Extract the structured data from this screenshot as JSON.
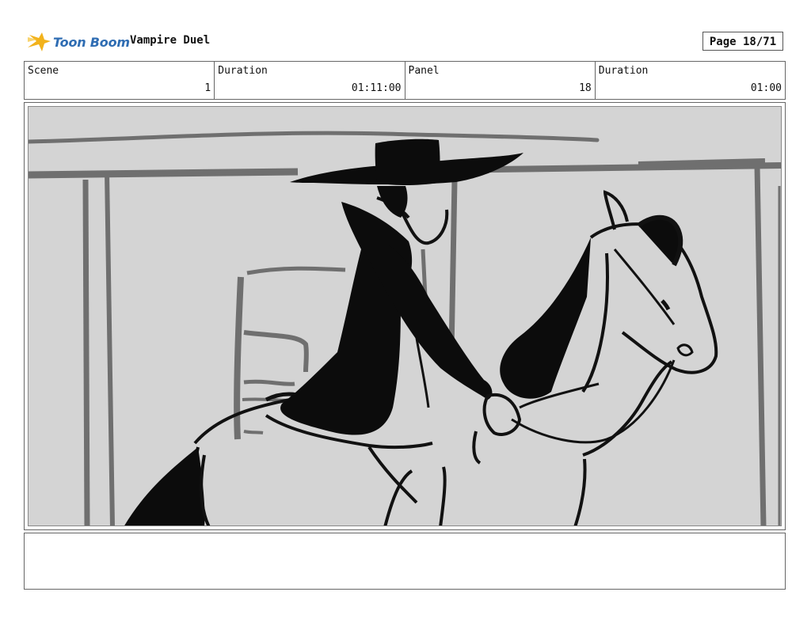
{
  "header": {
    "brand": "Toon Boom",
    "project_title": "Vampire Duel",
    "page_label": "Page 18/71"
  },
  "info": {
    "scene_label": "Scene",
    "scene_value": "1",
    "scene_duration_label": "Duration",
    "scene_duration_value": "01:11:00",
    "panel_label": "Panel",
    "panel_value": "18",
    "panel_duration_label": "Duration",
    "panel_duration_value": "01:00"
  },
  "panel": {
    "image_icon": "storyboard-sketch-rider-on-horse"
  },
  "colors": {
    "brand_blue": "#2f6db3",
    "brand_yellow": "#f2b21b",
    "sketch_bg": "#d4d4d4"
  }
}
